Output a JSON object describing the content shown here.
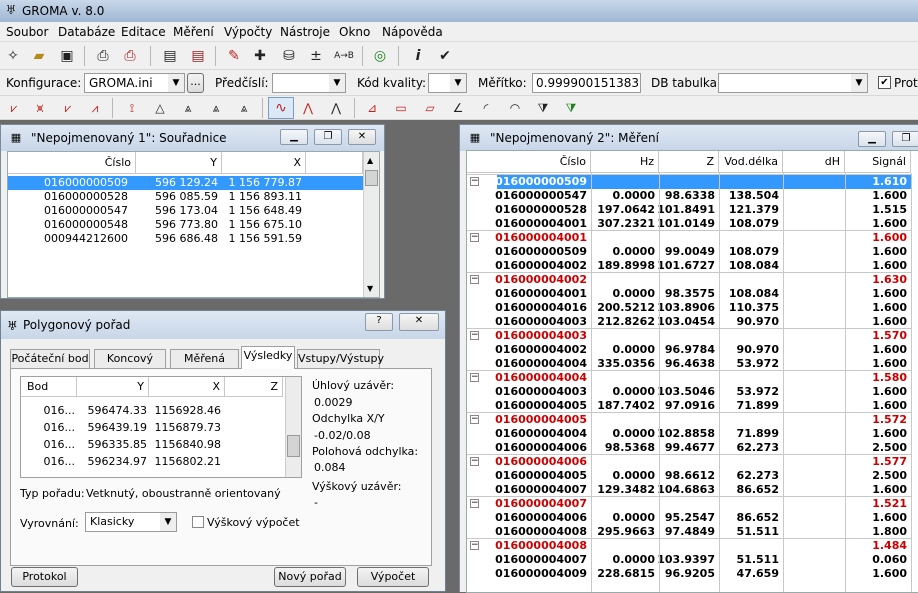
{
  "app": {
    "title": "GROMA v. 8.0"
  },
  "menu": [
    "Soubor",
    "Databáze",
    "Editace",
    "Měření",
    "Výpočty",
    "Nástroje",
    "Okno",
    "Nápověda"
  ],
  "toolbar2": {
    "konfigurace_label": "Konfigurace:",
    "konfigurace_value": "GROMA.ini",
    "browse": "...",
    "predcisli_label": "Předčíslí:",
    "predcisli_value": "",
    "kod_label": "Kód kvality:",
    "kod_value": "",
    "meritko_label": "Měřítko:",
    "meritko_value": "0.999900151383",
    "db_label": "DB tabulka:",
    "db_value": "",
    "proto_label": "Proto"
  },
  "win1": {
    "title": "\"Nepojmenovaný 1\": Souřadnice",
    "headers": [
      "Číslo",
      "Y",
      "X"
    ],
    "rows": [
      [
        "016000000509",
        "596 129.24",
        "1 156 779.87"
      ],
      [
        "016000000528",
        "596 085.59",
        "1 156 893.11"
      ],
      [
        "016000000547",
        "596 173.04",
        "1 156 648.49"
      ],
      [
        "016000000548",
        "596 773.80",
        "1 156 675.10"
      ],
      [
        "000944212600",
        "596 686.48",
        "1 156 591.59"
      ]
    ]
  },
  "win2": {
    "title": "\"Nepojmenovaný 2\": Měření",
    "headers": [
      "Číslo",
      "Hz",
      "Z",
      "Vod.délka",
      "dH",
      "Signál"
    ],
    "groups": [
      {
        "station": "016000000509",
        "signal": "1.610",
        "rows": [
          [
            "016000000547",
            "0.0000",
            "98.6338",
            "138.504",
            "1.600"
          ],
          [
            "016000000528",
            "197.0642",
            "101.8491",
            "121.379",
            "1.515"
          ],
          [
            "016000004001",
            "307.2321",
            "101.0149",
            "108.079",
            "1.600"
          ]
        ]
      },
      {
        "station": "016000004001",
        "signal": "1.600",
        "rows": [
          [
            "016000000509",
            "0.0000",
            "99.0049",
            "108.079",
            "1.600"
          ],
          [
            "016000004002",
            "189.8998",
            "101.6727",
            "108.084",
            "1.600"
          ]
        ]
      },
      {
        "station": "016000004002",
        "signal": "1.630",
        "rows": [
          [
            "016000004001",
            "0.0000",
            "98.3575",
            "108.084",
            "1.600"
          ],
          [
            "016000004016",
            "200.5212",
            "103.8906",
            "110.375",
            "1.600"
          ],
          [
            "016000004003",
            "212.8262",
            "103.0454",
            "90.970",
            "1.600"
          ]
        ]
      },
      {
        "station": "016000004003",
        "signal": "1.570",
        "rows": [
          [
            "016000004002",
            "0.0000",
            "96.9784",
            "90.970",
            "1.600"
          ],
          [
            "016000004004",
            "335.0356",
            "96.4638",
            "53.972",
            "1.600"
          ]
        ]
      },
      {
        "station": "016000004004",
        "signal": "1.580",
        "rows": [
          [
            "016000004003",
            "0.0000",
            "103.5046",
            "53.972",
            "1.600"
          ],
          [
            "016000004005",
            "187.7402",
            "97.0916",
            "71.899",
            "1.600"
          ]
        ]
      },
      {
        "station": "016000004005",
        "signal": "1.572",
        "rows": [
          [
            "016000004004",
            "0.0000",
            "102.8858",
            "71.899",
            "1.600"
          ],
          [
            "016000004006",
            "98.5368",
            "99.4677",
            "62.273",
            "2.500"
          ]
        ]
      },
      {
        "station": "016000004006",
        "signal": "1.577",
        "rows": [
          [
            "016000004005",
            "0.0000",
            "98.6612",
            "62.273",
            "2.500"
          ],
          [
            "016000004007",
            "129.3482",
            "104.6863",
            "86.652",
            "1.600"
          ]
        ]
      },
      {
        "station": "016000004007",
        "signal": "1.521",
        "rows": [
          [
            "016000004006",
            "0.0000",
            "95.2547",
            "86.652",
            "1.600"
          ],
          [
            "016000004008",
            "295.9663",
            "97.4849",
            "51.511",
            "1.800"
          ]
        ]
      },
      {
        "station": "016000004008",
        "signal": "1.484",
        "rows": [
          [
            "016000004007",
            "0.0000",
            "103.9397",
            "51.511",
            "0.060"
          ],
          [
            "016000004009",
            "228.6815",
            "96.9205",
            "47.659",
            "1.600"
          ]
        ]
      }
    ]
  },
  "dialog": {
    "title": "Polygonový pořad",
    "help": "?",
    "close": "✕",
    "tabs": [
      "Počáteční bod",
      "Koncový bod",
      "Měřená data",
      "Výsledky",
      "Vstupy/Výstupy"
    ],
    "active_tab": "Výsledky",
    "list_headers": [
      "Bod",
      "Y",
      "X",
      "Z"
    ],
    "list_rows": [
      [
        "016...",
        "596474.33",
        "1156928.46"
      ],
      [
        "016...",
        "596439.19",
        "1156879.73"
      ],
      [
        "016...",
        "596335.85",
        "1156840.98"
      ],
      [
        "016...",
        "596234.97",
        "1156802.21"
      ]
    ],
    "uhlovy_label": "Úhlový uzávěr:",
    "uhlovy_value": "0.0029",
    "odchylka_label": "Odchylka X/Y",
    "odchylka_value": "-0.02/0.08",
    "polohova_label": "Polohová odchylka:",
    "polohova_value": "0.084",
    "vyskovy_label": "Výškový uzávěr:",
    "vyskovy_value": "-",
    "typ_label": "Typ pořadu:",
    "typ_value": "Vetknutý, oboustranně orientovaný",
    "vyrovnani_label": "Vyrovnání:",
    "vyrovnani_value": "Klasicky",
    "vyskovy_vypocet": "Výškový výpočet",
    "btn_protokol": "Protokol",
    "btn_novy": "Nový pořad",
    "btn_vypocet": "Výpočet"
  },
  "colors": {
    "selection": "#3399ff",
    "station": "#cc0000",
    "title_bg": "#c7d6e8"
  }
}
